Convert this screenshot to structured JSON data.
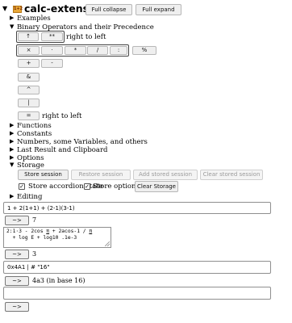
{
  "header": {
    "title": "calc-extension",
    "logo_text": "1+2",
    "collapse_label": "Full collapse",
    "expand_label": "Full expand"
  },
  "sections": {
    "examples": "Examples",
    "binary_ops": "Binary Operators and their Precedence",
    "functions": "Functions",
    "constants": "Constants",
    "numbers": "Numbers, some Variables, and others",
    "last_result": "Last Result and Clipboard",
    "options": "Options",
    "storage": "Storage",
    "editing": "Editing"
  },
  "operators": {
    "row1": [
      "↑",
      "**"
    ],
    "row1_note": "right to left",
    "row2": [
      "×",
      "·",
      "*",
      "/",
      ":",
      "%"
    ],
    "plus": "+",
    "minus": "-",
    "amp": "&",
    "caret": "^",
    "pipe": "|",
    "equals": "=",
    "equals_note": "right to left"
  },
  "storage": {
    "store_session": "Store session",
    "restore_session": "Restore session",
    "add_stored_session": "Add stored session",
    "clear_stored_session": "Clear stored session",
    "store_accordion_label": "Store accordion state",
    "store_options_label": "Store options",
    "clear_storage": "Clear Storage",
    "store_accordion_checked": true,
    "store_options_checked": true
  },
  "calc": {
    "arrow_label": "~>",
    "entry1": "1 + 2(1+1) + (2-1)(3-1)",
    "result1": "7",
    "entry2_lines": [
      {
        "pre": "2:1·3 - 2cos ",
        "u1": "π",
        "mid": " + 2acos-1 / ",
        "u2": "π"
      },
      {
        "pre": "  + log E + log10 .1e-3",
        "u1": "",
        "mid": "",
        "u2": ""
      }
    ],
    "result2": "3",
    "entry3": "0x4A1 | # \"16\"",
    "result3": "4a3 (in base 16)",
    "entry4": ""
  },
  "colors": {
    "logo": "#e8a838",
    "button_bg": "#efefef"
  }
}
